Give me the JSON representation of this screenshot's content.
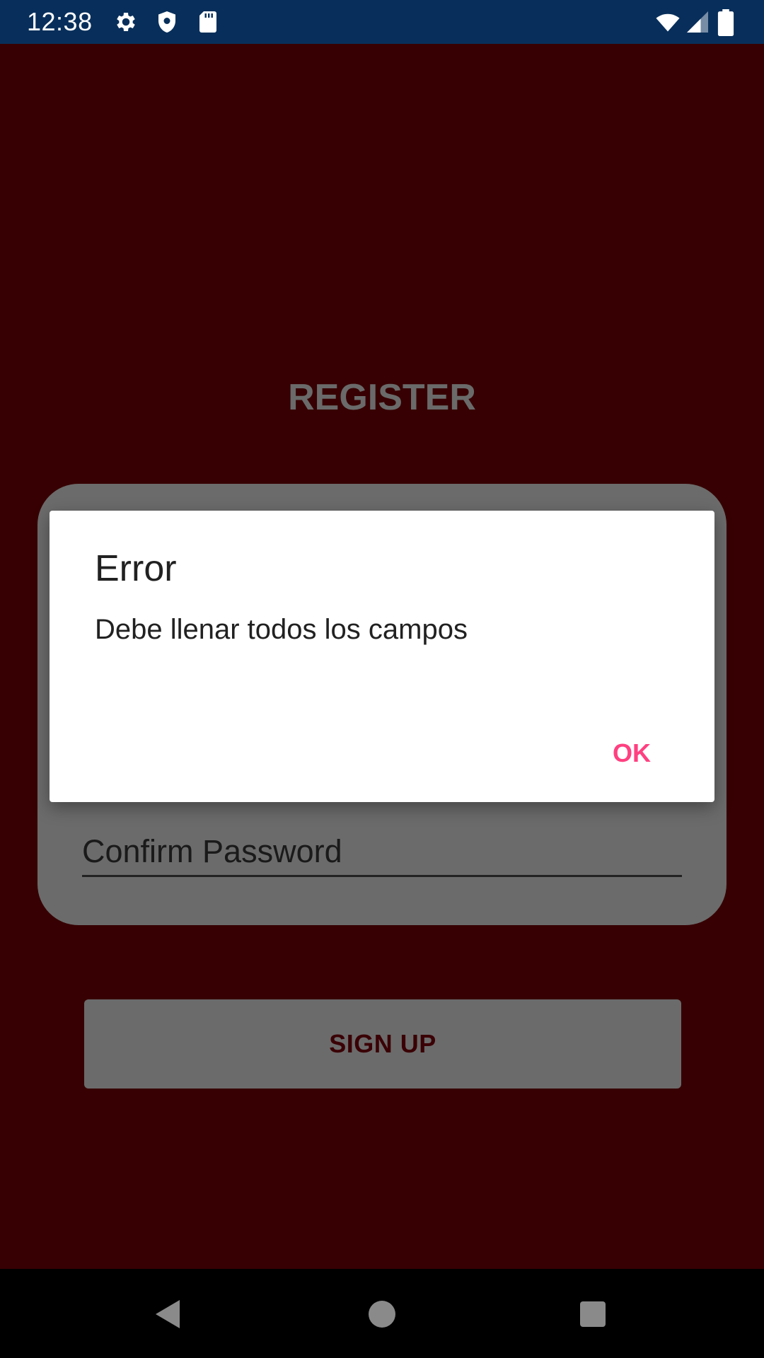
{
  "status_bar": {
    "time": "12:38",
    "icons": [
      "gear-icon",
      "shield-icon",
      "sd-card-icon",
      "wifi-icon",
      "cell-signal-icon",
      "battery-icon"
    ],
    "background": "#082f5b"
  },
  "screen": {
    "title": "REGISTER",
    "fields": {
      "confirm_password_placeholder": "Confirm Password"
    },
    "signup_label": "SIGN UP",
    "background": "#370003"
  },
  "dialog": {
    "title": "Error",
    "message": "Debe llenar todos los campos",
    "ok_label": "OK",
    "accent": "#ff4081"
  },
  "nav_bar": {
    "icons": [
      "back-icon",
      "home-icon",
      "recents-icon"
    ]
  }
}
